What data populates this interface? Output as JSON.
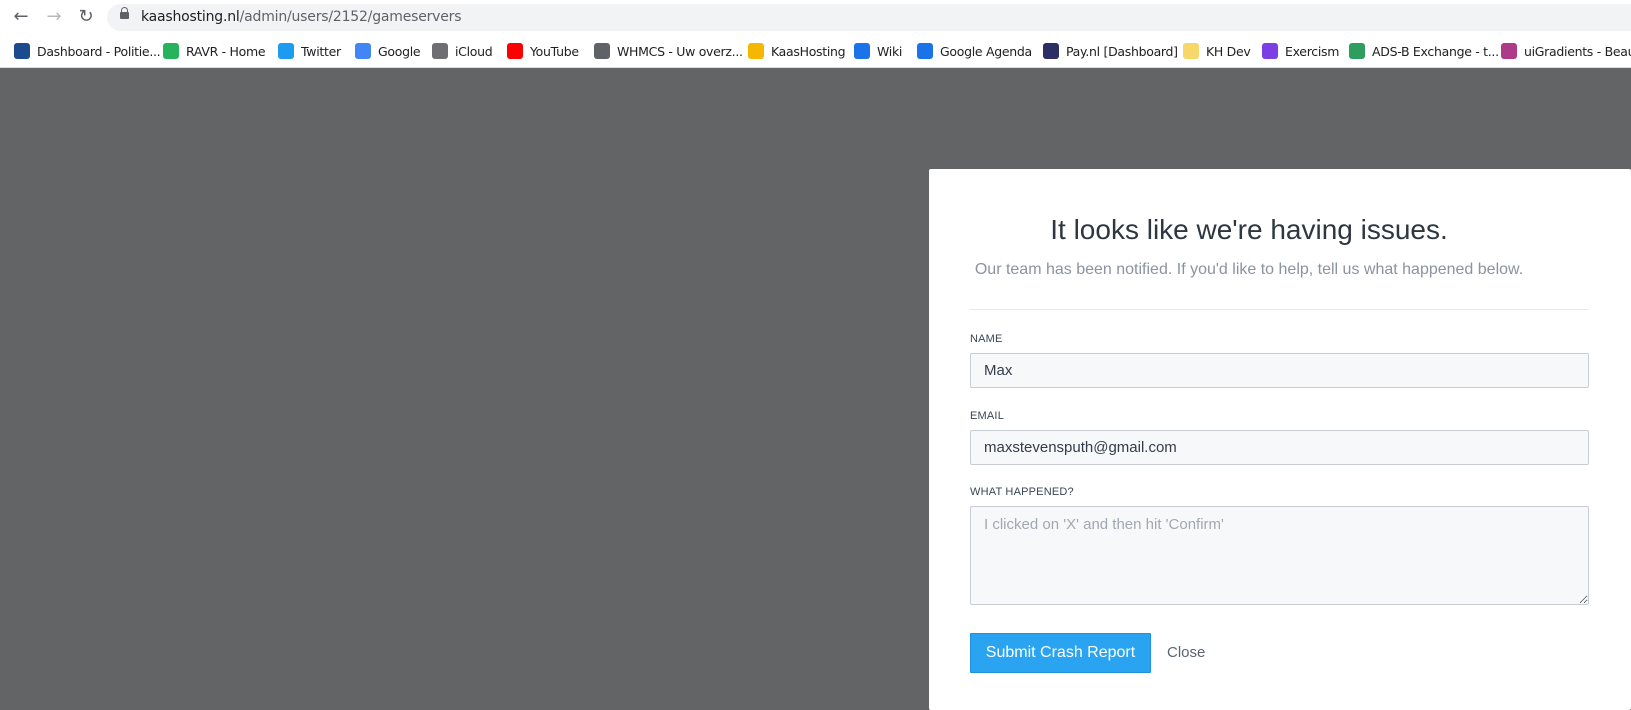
{
  "browser": {
    "nav": {
      "back_icon": "←",
      "forward_icon": "→",
      "reload_icon": "↻"
    },
    "url": {
      "host": "kaashosting.nl",
      "path": "/admin/users/2152/gameservers"
    }
  },
  "bookmarks": [
    {
      "label": "Dashboard - Politie...",
      "icon": "politie-icon",
      "color": "#1b4a8f"
    },
    {
      "label": "RAVR - Home",
      "icon": "ravr-icon",
      "color": "#27b35c"
    },
    {
      "label": "Twitter",
      "icon": "twitter-icon",
      "color": "#1d9bf0"
    },
    {
      "label": "Google",
      "icon": "google-icon",
      "color": "#4285f4"
    },
    {
      "label": "iCloud",
      "icon": "apple-icon",
      "color": "#6e6e73"
    },
    {
      "label": "YouTube",
      "icon": "youtube-icon",
      "color": "#ff0000"
    },
    {
      "label": "WHMCS - Uw overz...",
      "icon": "globe-icon",
      "color": "#5f6368"
    },
    {
      "label": "KaasHosting",
      "icon": "cheese-icon",
      "color": "#f5b700"
    },
    {
      "label": "Wiki",
      "icon": "wiki-icon",
      "color": "#1a73e8"
    },
    {
      "label": "Google Agenda",
      "icon": "calendar-icon",
      "color": "#1a73e8"
    },
    {
      "label": "Pay.nl [Dashboard]",
      "icon": "paynl-icon",
      "color": "#2b2f64"
    },
    {
      "label": "KH Dev",
      "icon": "folder-icon",
      "color": "#f7d66a"
    },
    {
      "label": "Exercism",
      "icon": "exercism-icon",
      "color": "#7b3fe4"
    },
    {
      "label": "ADS-B Exchange - t...",
      "icon": "adsb-icon",
      "color": "#2e9e5e"
    },
    {
      "label": "uiGradients - Beauti",
      "icon": "uigradients-icon",
      "color": "#b03a8a"
    }
  ],
  "dialog": {
    "title": "It looks like we're having issues.",
    "subtitle": "Our team has been notified. If you'd like to help, tell us what happened below.",
    "name_label": "NAME",
    "name_value": "Max",
    "email_label": "EMAIL",
    "email_value": "maxstevensputh@gmail.com",
    "what_label": "WHAT HAPPENED?",
    "what_placeholder": "I clicked on 'X' and then hit 'Confirm'",
    "submit_label": "Submit Crash Report",
    "close_label": "Close",
    "accent_color": "#2aa4f1"
  }
}
